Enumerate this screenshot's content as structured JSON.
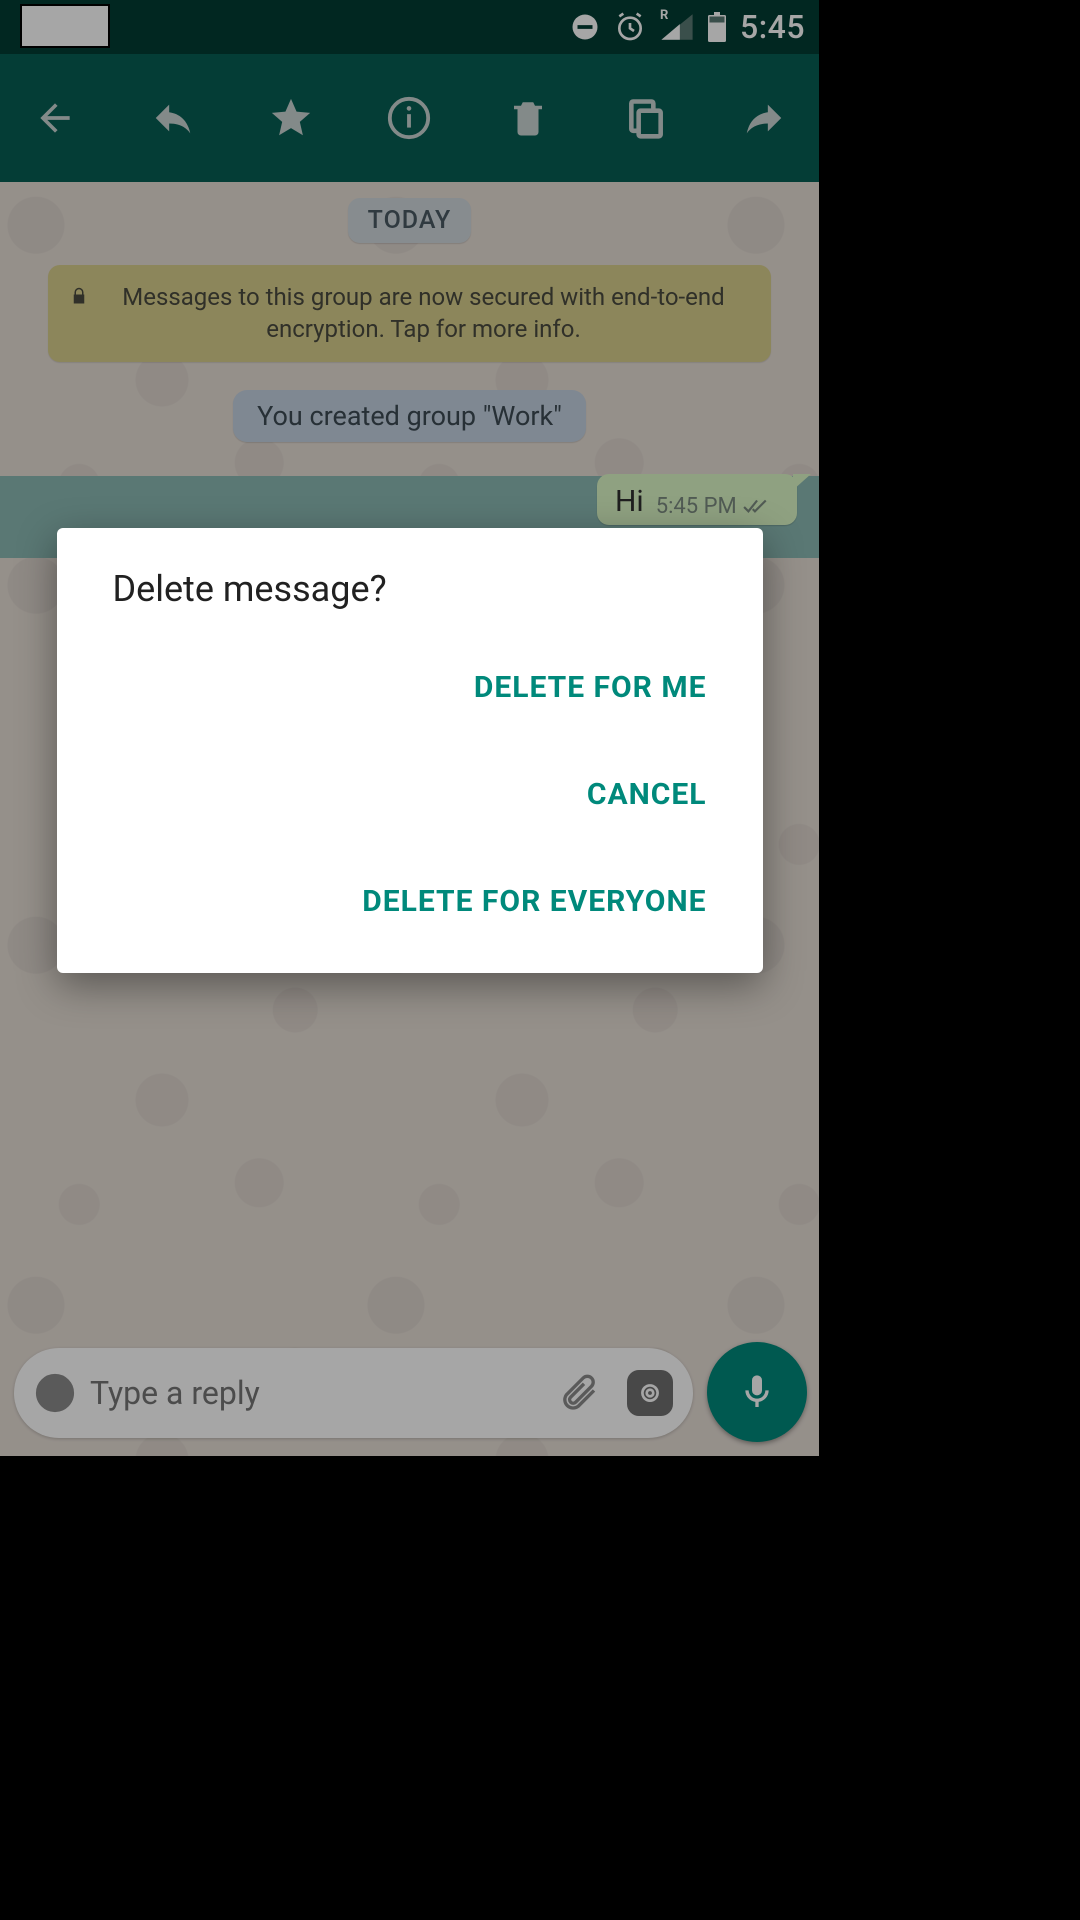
{
  "status": {
    "time": "5:45",
    "roaming_indicator": "R"
  },
  "chat": {
    "date_label": "TODAY",
    "encryption_text": "Messages to this group are now secured with end-to-end encryption. Tap for more info.",
    "system_event": "You created group \"Work\"",
    "messages": [
      {
        "text": "Hi",
        "time": "5:45 PM",
        "status": "delivered"
      }
    ]
  },
  "input": {
    "placeholder": "Type a reply"
  },
  "dialog": {
    "title": "Delete message?",
    "delete_me": "DELETE FOR ME",
    "cancel": "CANCEL",
    "delete_everyone": "DELETE FOR EVERYONE"
  }
}
